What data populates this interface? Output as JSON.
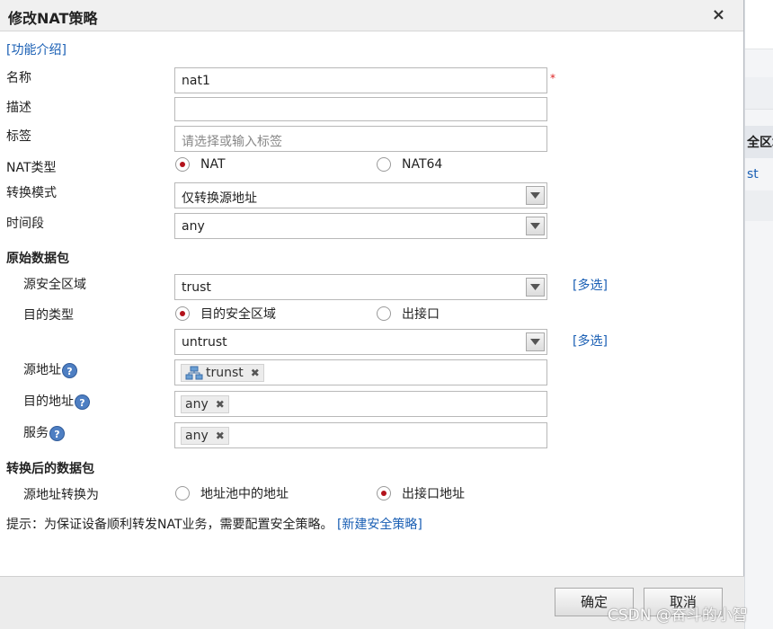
{
  "background": {
    "header": "全区域",
    "link": "st"
  },
  "dialog": {
    "title": "修改NAT策略",
    "close_symbol": "×",
    "intro_link": "[功能介绍]"
  },
  "form": {
    "name": {
      "label": "名称",
      "value": "nat1",
      "required_mark": "*"
    },
    "desc": {
      "label": "描述",
      "value": ""
    },
    "tags": {
      "label": "标签",
      "placeholder": "请选择或输入标签"
    },
    "nat_type": {
      "label": "NAT类型",
      "options": [
        "NAT",
        "NAT64"
      ],
      "selected": "NAT"
    },
    "mode": {
      "label": "转换模式",
      "value": "仅转换源地址"
    },
    "schedule": {
      "label": "时间段",
      "value": "any"
    }
  },
  "original_packet": {
    "section_title": "原始数据包",
    "src_zone": {
      "label": "源安全区域",
      "value": "trust",
      "multi_link": "[多选]"
    },
    "dst_type": {
      "label": "目的类型",
      "options": [
        "目的安全区域",
        "出接口"
      ],
      "selected": "目的安全区域"
    },
    "dst_zone": {
      "value": "untrust",
      "multi_link": "[多选]"
    },
    "src_addr": {
      "label": "源地址",
      "tag": "trunst",
      "tag_icon": "network-icon"
    },
    "dst_addr": {
      "label": "目的地址",
      "tag": "any"
    },
    "service": {
      "label": "服务",
      "tag": "any"
    },
    "help_symbol": "?",
    "remove_symbol": "✖"
  },
  "translated_packet": {
    "section_title": "转换后的数据包",
    "src_translate": {
      "label": "源地址转换为",
      "options": [
        "地址池中的地址",
        "出接口地址"
      ],
      "selected": "出接口地址"
    }
  },
  "hint": {
    "text": "提示：为保证设备顺利转发NAT业务，需要配置安全策略。",
    "link": "[新建安全策略]"
  },
  "footer": {
    "ok": "确定",
    "cancel": "取消"
  },
  "watermark": "CSDN @奋斗的小智",
  "colors": {
    "link": "#1a5fb4",
    "radio_selected": "#b3121b",
    "required": "#dd2222"
  }
}
